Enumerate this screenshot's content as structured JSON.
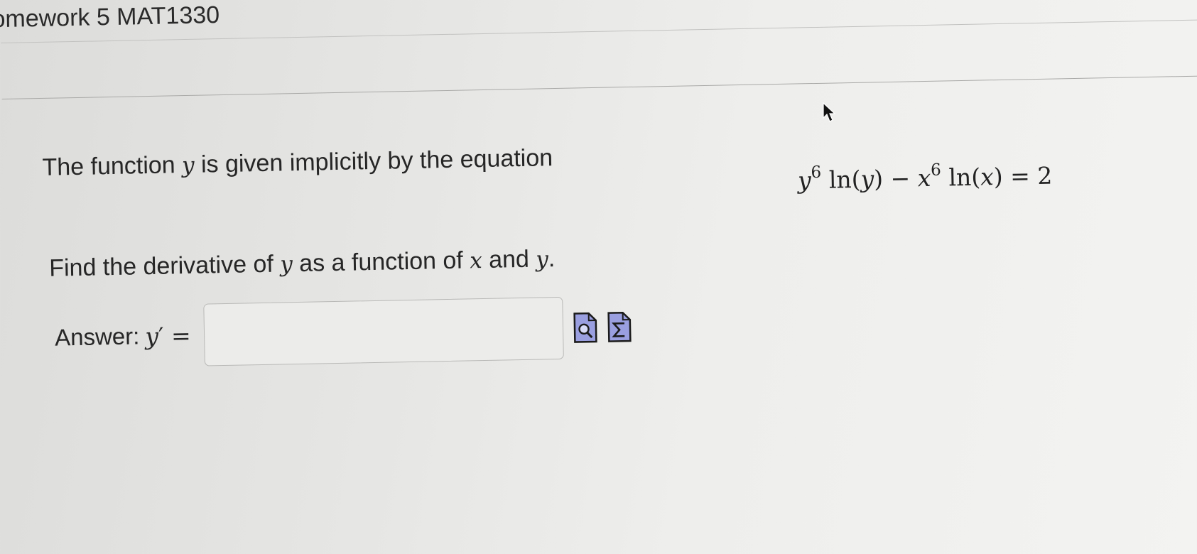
{
  "header": {
    "title": "omework 5 MAT1330"
  },
  "problem": {
    "prompt_before": "The function ",
    "prompt_var": "y",
    "prompt_after": " is given implicitly by the equation",
    "equation": {
      "term1_base": "y",
      "term1_exp": "6",
      "term1_fn": "ln(",
      "term1_arg": "y",
      "term1_close": ")",
      "minus": "−",
      "term2_base": "x",
      "term2_exp": "6",
      "term2_fn": "ln(",
      "term2_arg": "x",
      "term2_close": ")",
      "equals": "=",
      "rhs": "2"
    },
    "instruction_before": "Find the derivative of ",
    "instruction_var1": "y",
    "instruction_mid": " as a function of ",
    "instruction_var2": "x",
    "instruction_and": " and ",
    "instruction_var3": "y",
    "instruction_end": "."
  },
  "answer": {
    "label": "Answer:",
    "lhs_var": "y",
    "lhs_prime": "′",
    "lhs_equals": " =",
    "value": "",
    "preview_icon": "preview-icon",
    "equation_editor_icon": "equation-editor-icon"
  },
  "colors": {
    "icon_fill": "#9a9fe0",
    "icon_border": "#1b1b1b"
  }
}
